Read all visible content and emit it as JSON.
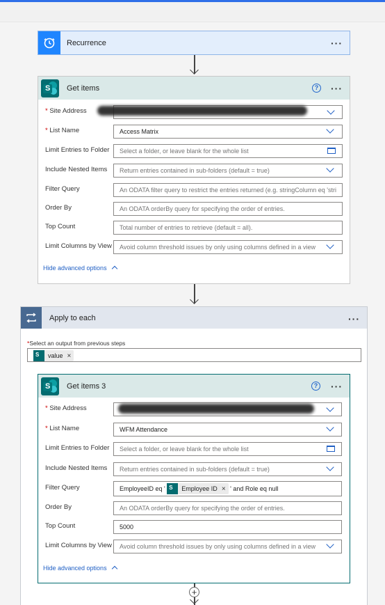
{
  "recurrence": {
    "title": "Recurrence",
    "more": "···"
  },
  "get_items": {
    "title": "Get items",
    "help": "?",
    "more": "···",
    "fields": [
      {
        "label": "Site Address",
        "required": true,
        "value": "",
        "redacted": true,
        "control": "dropdown"
      },
      {
        "label": "List Name",
        "required": true,
        "value": "Access Matrix",
        "control": "dropdown"
      },
      {
        "label": "Limit Entries to Folder",
        "required": false,
        "placeholder": "Select a folder, or leave blank for the whole list",
        "control": "folder"
      },
      {
        "label": "Include Nested Items",
        "required": false,
        "placeholder": "Return entries contained in sub-folders (default = true)",
        "control": "dropdown"
      },
      {
        "label": "Filter Query",
        "required": false,
        "placeholder": "An ODATA filter query to restrict the entries returned (e.g. stringColumn eq 'stri",
        "control": "text"
      },
      {
        "label": "Order By",
        "required": false,
        "placeholder": "An ODATA orderBy query for specifying the order of entries.",
        "control": "text"
      },
      {
        "label": "Top Count",
        "required": false,
        "placeholder": "Total number of entries to retrieve (default = all).",
        "control": "text"
      },
      {
        "label": "Limit Columns by View",
        "required": false,
        "placeholder": "Avoid column threshold issues by only using columns defined in a view",
        "control": "dropdown"
      }
    ],
    "advanced_link": "Hide advanced options"
  },
  "apply_to_each": {
    "title": "Apply to each",
    "more": "···",
    "select_label": "Select an output from previous steps",
    "token": "value",
    "token_remove": "×"
  },
  "get_items_3": {
    "title": "Get items 3",
    "help": "?",
    "more": "···",
    "fields": [
      {
        "label": "Site Address",
        "required": true,
        "value": "",
        "redacted": true,
        "control": "dropdown"
      },
      {
        "label": "List Name",
        "required": true,
        "value": "WFM Attendance",
        "control": "dropdown"
      },
      {
        "label": "Limit Entries to Folder",
        "required": false,
        "placeholder": "Select a folder, or leave blank for the whole list",
        "control": "folder"
      },
      {
        "label": "Include Nested Items",
        "required": false,
        "placeholder": "Return entries contained in sub-folders (default = true)",
        "control": "dropdown"
      },
      {
        "label": "Filter Query",
        "required": false,
        "control": "expression"
      },
      {
        "label": "Order By",
        "required": false,
        "placeholder": "An ODATA orderBy query for specifying the order of entries.",
        "control": "text"
      },
      {
        "label": "Top Count",
        "required": false,
        "value": "5000",
        "control": "text"
      },
      {
        "label": "Limit Columns by View",
        "required": false,
        "placeholder": "Avoid column threshold issues by only using columns defined in a view",
        "control": "dropdown"
      }
    ],
    "filter_prefix": "EmployeeID eq '",
    "filter_token": "Employee ID",
    "filter_token_remove": "×",
    "filter_suffix": "' and Role eq null",
    "advanced_link": "Hide advanced options"
  },
  "add_step": "+",
  "icons": {
    "recurrence": "alarm-clock-icon",
    "sharepoint": "sharepoint-icon",
    "loop": "loop-icon"
  },
  "colors": {
    "recurrence_header": "#e3eefc",
    "recurrence_icon": "#1f85ff",
    "sharepoint_header": "#dae9e8",
    "sharepoint_brand": "#036c70",
    "apply_header": "#e1e6ee",
    "apply_icon": "#486991",
    "link": "#1f5fc4",
    "required": "#c00000"
  }
}
